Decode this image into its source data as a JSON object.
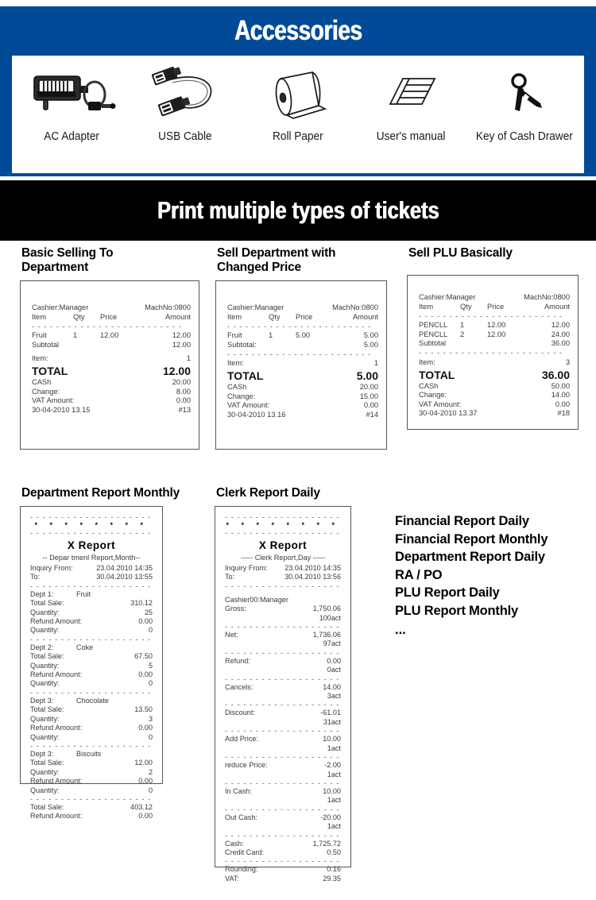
{
  "accessories": {
    "title": "Accessories",
    "items": [
      {
        "label": "AC Adapter",
        "icon": "ac-adapter-icon"
      },
      {
        "label": "USB Cable",
        "icon": "usb-cable-icon"
      },
      {
        "label": "Roll Paper",
        "icon": "roll-paper-icon"
      },
      {
        "label": "User's manual",
        "icon": "users-manual-icon"
      },
      {
        "label": "Key of Cash Drawer",
        "icon": "cash-drawer-key-icon"
      }
    ]
  },
  "tickets_banner": {
    "title": "Print multiple types of tickets"
  },
  "colors": {
    "brand_blue": "#004a98",
    "banner_black": "#000000",
    "receipt_border": "#555555"
  },
  "receipts": {
    "basic_selling": {
      "title": "Basic Selling To Department",
      "header": {
        "cashier": "Cashier:Manager",
        "machno": "MachNo:0800"
      },
      "columns": [
        "Item",
        "Qty",
        "Price",
        "Amount"
      ],
      "rows": [
        {
          "item": "Fruit",
          "qty": "1",
          "price": "12.00",
          "amount": "12.00"
        },
        {
          "item": "Subtotal",
          "qty": "",
          "price": "",
          "amount": "12.00"
        }
      ],
      "item_count_label": "Item:",
      "item_count": "1",
      "total_label": "TOTAL",
      "total": "12.00",
      "cash_label": "CASh",
      "cash": "20.00",
      "change_label": "Change:",
      "change": "8.00",
      "vat_label": "VAT Amount:",
      "vat": "0.00",
      "datetime": "30-04-2010 13.15",
      "ticket_no": "#13"
    },
    "changed_price": {
      "title": "Sell Department with Changed Price",
      "header": {
        "cashier": "Cashier:Manager",
        "machno": "MachNo:0800"
      },
      "columns": [
        "Item",
        "Qty",
        "Price",
        "Amount"
      ],
      "rows": [
        {
          "item": "Fruit",
          "qty": "1",
          "price": "5.00",
          "amount": "5.00"
        },
        {
          "item": "Subtotal:",
          "qty": "",
          "price": "",
          "amount": "5.00"
        }
      ],
      "item_count_label": "Item:",
      "item_count": "1",
      "total_label": "TOTAL",
      "total": "5.00",
      "cash_label": "CASh",
      "cash": "20.00",
      "change_label": "Change:",
      "change": "15.00",
      "vat_label": "VAT Amount:",
      "vat": "0.00",
      "datetime": "30-04-2010 13.16",
      "ticket_no": "#14"
    },
    "sell_plu": {
      "title": "Sell PLU Basically",
      "header": {
        "cashier": "Cashier:Manager",
        "machno": "MachNo:0800"
      },
      "columns": [
        "Item",
        "Qty",
        "Price",
        "Amount"
      ],
      "rows": [
        {
          "item": "PENCLL",
          "qty": "1",
          "price": "12.00",
          "amount": "12.00"
        },
        {
          "item": "PENCLL",
          "qty": "2",
          "price": "12.00",
          "amount": "24.00"
        },
        {
          "item": "Subtotal",
          "qty": "",
          "price": "",
          "amount": "36.00"
        }
      ],
      "item_count_label": "Item:",
      "item_count": "3",
      "total_label": "TOTAL",
      "total": "36.00",
      "cash_label": "CASh",
      "cash": "50.00",
      "change_label": "Change:",
      "change": "14.00",
      "vat_label": "VAT Amount:",
      "vat": "0.00",
      "datetime": "30-04-2010 13.37",
      "ticket_no": "#18"
    }
  },
  "department_report": {
    "title": "Department  Report  Monthly",
    "stars": "*  *  *  *  *  *  *  *",
    "report_name": "X   Report",
    "report_sub": "-- Depar tmenl Report,Month--",
    "inquiry_from_label": "Inquiry From:",
    "inquiry_from": "23.04.2010 14:35",
    "to_label": "To:",
    "to": "30.04.2010 13:55",
    "departments": [
      {
        "dept": "Dept 1:",
        "name": "Fruit",
        "total_sale_label": "Total Sale:",
        "total_sale": "310.12",
        "qty_label": "Quantity:",
        "qty": "25",
        "refund_label": "Refund Amount:",
        "refund": "0.00",
        "refund_qty_label": "Quantity:",
        "refund_qty": "0"
      },
      {
        "dept": "Dept 2:",
        "name": "Coke",
        "total_sale_label": "Total Sale:",
        "total_sale": "67.50",
        "qty_label": "Quantity:",
        "qty": "5",
        "refund_label": "Refund Amount:",
        "refund": "0.00",
        "refund_qty_label": "Quantity:",
        "refund_qty": "0"
      },
      {
        "dept": "Dept 3:",
        "name": "Chocolate",
        "total_sale_label": "Total Sale:",
        "total_sale": "13.50",
        "qty_label": "Quantity:",
        "qty": "3",
        "refund_label": "Refund Amount:",
        "refund": "0.00",
        "refund_qty_label": "Quantity:",
        "refund_qty": "0"
      },
      {
        "dept": "Dept 3:",
        "name": "Biscuits",
        "total_sale_label": "Total Sale:",
        "total_sale": "12.00",
        "qty_label": "Quantity:",
        "qty": "2",
        "refund_label": "Refund Amount:",
        "refund": "0.00",
        "refund_qty_label": "Quantity:",
        "refund_qty": "0"
      }
    ],
    "grand_total_sale_label": "Total Sale:",
    "grand_total_sale": "403.12",
    "grand_refund_label": "Refund Amount:",
    "grand_refund": "0.00"
  },
  "clerk_report": {
    "title": "Clerk Report  Daily",
    "stars": "*  *  *  *  *  *  *  *",
    "report_name": "X   Report",
    "report_sub": "----- Clerk Report,Day  -----",
    "inquiry_from_label": "Inquiry From:",
    "inquiry_from": "23.04.2010 14:35",
    "to_label": "To:",
    "to": "30.04.2010 13:56",
    "cashier": "Cashier00:Manager",
    "entries": [
      {
        "label": "Gross:",
        "value": "1,750.06",
        "count": "100act"
      },
      {
        "label": "Net:",
        "value": "1,736.06",
        "count": "97act"
      },
      {
        "label": "Refund:",
        "value": "0.00",
        "count": "0act"
      },
      {
        "label": "Cancels:",
        "value": "14.00",
        "count": "3act"
      },
      {
        "label": "Discount:",
        "value": "-61.01",
        "count": "31act"
      },
      {
        "label": "Add Price:",
        "value": "10.00",
        "count": "1act"
      },
      {
        "label": "reduce Price:",
        "value": "-2.00",
        "count": "1act"
      },
      {
        "label": "In Cash:",
        "value": "10.00",
        "count": "1act"
      },
      {
        "label": "Out Cash:",
        "value": "-20.00",
        "count": "1act"
      }
    ],
    "cash_label": "Cash:",
    "cash": "1,725.72",
    "credit_label": "Credit Card:",
    "credit": "0.50",
    "rounding_label": "Rounding:",
    "rounding": "0.16",
    "vat_label": "VAT:",
    "vat": "29.35"
  },
  "report_list": {
    "items": [
      "Financial Report Daily",
      "Financial Report Monthly",
      "Department Report Daily",
      "RA / PO",
      "PLU Report Daily",
      "PLU Report Monthly"
    ],
    "ellipsis": "..."
  }
}
